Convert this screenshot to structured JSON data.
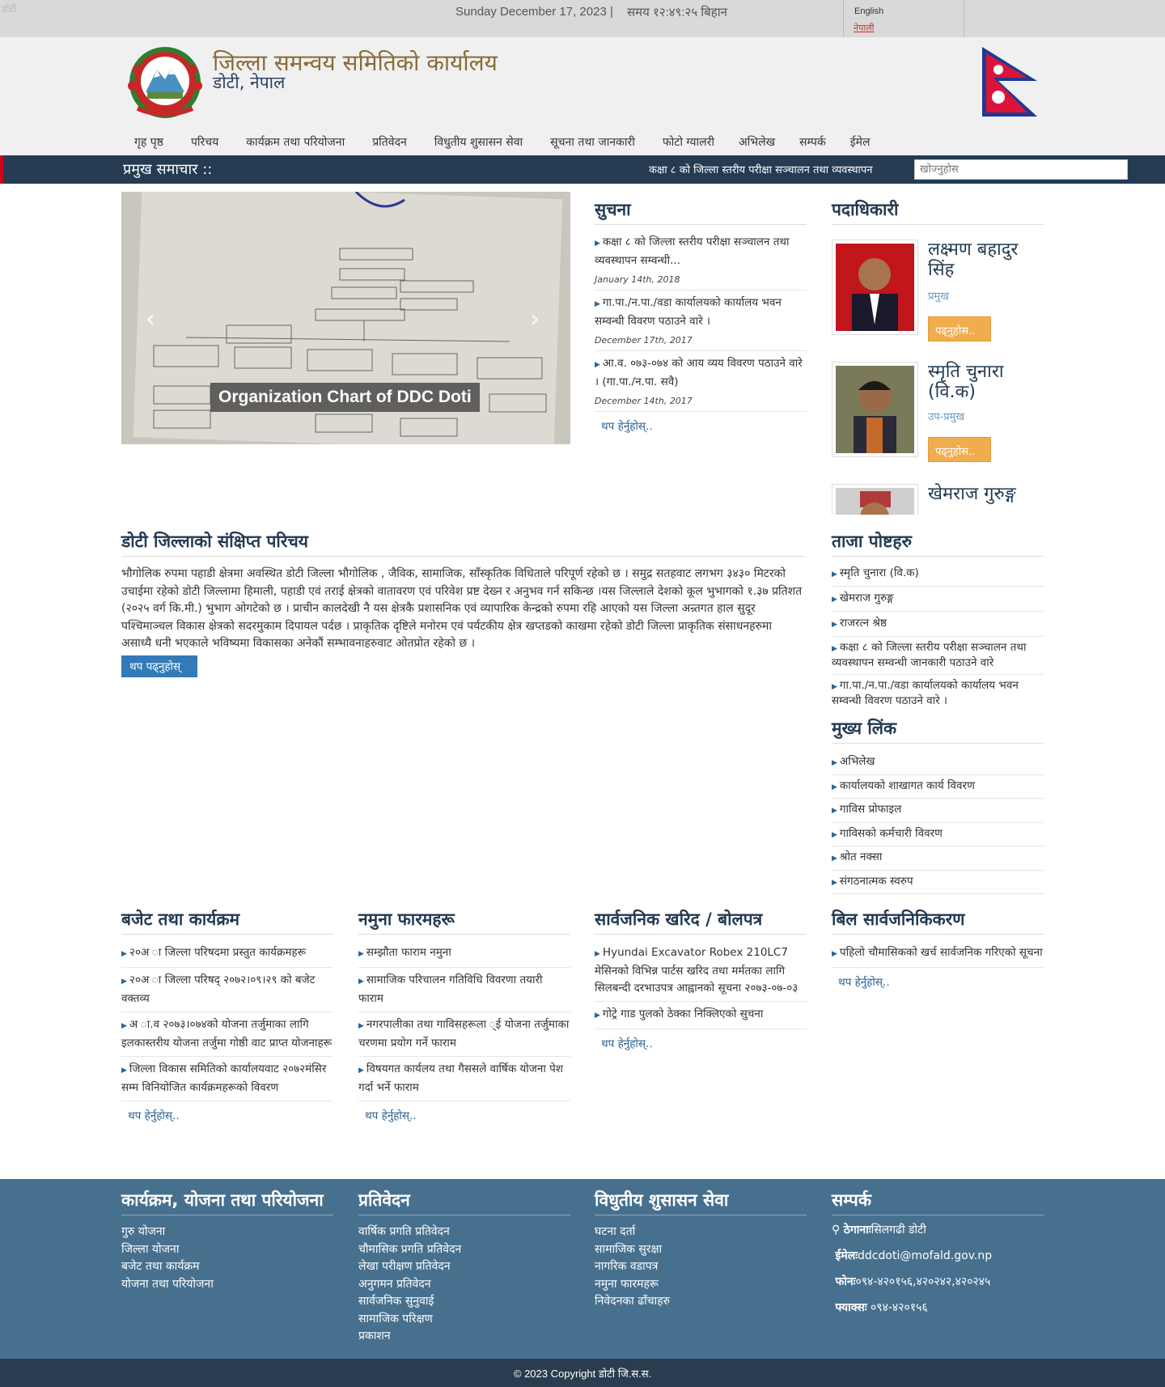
{
  "topbar": {
    "broken_image_alt": "डोटी",
    "date": "Sunday December 17, 2023 |",
    "time": "समय १२:४९:२५ बिहान",
    "lang_en": "English",
    "lang_np": "नेपाली"
  },
  "header": {
    "title": "जिल्ला समन्वय समितिको कार्यालय",
    "subtitle": "डोटी, नेपाल"
  },
  "nav": [
    "गृह पृष्ठ",
    "परिचय",
    "कार्यक्रम तथा परियोजना",
    "प्रतिवेदन",
    "विधुतीय शुसासन सेवा",
    "सूचना तथा जानकारी",
    "फोटो ग्यालरी",
    "अभिलेख",
    "सम्पर्क",
    "ईमेल"
  ],
  "newsbar": {
    "label": "प्रमुख समाचार ::",
    "ticker": "कक्षा ८ को जिल्ला स्तरीय परीक्षा सञ्चालन तथा व्यवस्थापन",
    "search_placeholder": "खोज्नुहोस"
  },
  "slider": {
    "caption": "Organization Chart of DDC Doti",
    "prev": "‹",
    "next": "›"
  },
  "notice": {
    "heading": "सुचना",
    "items": [
      {
        "text": "कक्षा ८ को जिल्ला स्तरीय परीक्षा सञ्चालन तथा व्यवस्थापन सम्वन्धी...",
        "date": "January 14th, 2018"
      },
      {
        "text": "गा.पा./न.पा./वडा कार्यालयको कार्यालय भवन सम्वन्धी विवरण पठाउने वारे ।",
        "date": "December 17th, 2017"
      },
      {
        "text": "आ.व. ०७३-०७४ को आय व्यय विवरण पठाउने वारे । (गा.पा./न.पा. सवै)",
        "date": "December 14th, 2017"
      }
    ],
    "more": "थप हेर्नुहोस्.."
  },
  "officials": {
    "heading": "पदाधिकारी",
    "people": [
      {
        "name": "लक्ष्मण बहादुर सिंह",
        "role": "प्रमुख",
        "button": "पढ्नुहोस.."
      },
      {
        "name": "स्मृति चुनारा (वि.क)",
        "role": "उप-प्रमुख",
        "button": "पढ्नुहोस.."
      },
      {
        "name": "खेमराज गुरुङ्ग",
        "role": "",
        "button": ""
      }
    ]
  },
  "intro": {
    "heading": "डोटी जिल्लाको संक्षिप्त परिचय",
    "text": "भौगोलिक रुपमा पहाडी क्षेत्रमा अवस्थित डोटी जिल्ला भौगोलिक , जैविक, सामाजिक, साँस्कृतिक विधिताले परिपूर्ण रहेको छ । समुद्र सतहवाट लगभग ३४३० मिटरको उचाईमा रहेको डोटी जिल्लामा हिमाली, पहाडी एवं तराई क्षेत्रको वातावरण एवं परिवेश प्रष्ट देख्न र अनुभव गर्न सकिन्छ ।यस जिल्लाले देशको कूल भुभागको १.३७ प्रतिशत (२०२५ वर्ग कि.मी.) भुभाग ओगटेको छ । प्राचीन कालदेखी नै यस क्षेत्रकै प्रशासनिक एवं व्यापारिक केन्द्रको रुपमा रहि आएको यस जिल्ला अन्र्तगत हाल सुदूर पश्चिमाञ्चल विकास क्षेत्रको सदरमुकाम दिपायल पर्दछ । प्राकृतिक दृष्टिले मनोरम एवं पर्यटकीय क्षेत्र खप्तडको काखमा रहेको डोटी जिल्ला प्राकृतिक संसाधनहरुमा असाध्यै धनी भएकाले भविष्यमा विकासका अनेकौं सम्भावनाहरुवाट ओतप्रोत रहेको छ ।",
    "read_more": "थप पढ्नुहोस्"
  },
  "latest_posts": {
    "heading": "ताजा पोष्टहरु",
    "items": [
      "स्मृति चुनारा (वि.क)",
      "खेमराज गुरुङ्ग",
      "राजरत्न श्रेष्ठ",
      "कक्षा ८ को जिल्ला स्तरीय परीक्षा सञ्चालन तथा व्यवस्थापन सम्वन्धी जानकारी पठाउने वारे",
      "गा.पा./न.पा./वडा कार्यालयको कार्यालय भवन सम्वन्धी विवरण पठाउने वारे ।"
    ]
  },
  "main_links": {
    "heading": "मुख्य लिंक",
    "items": [
      "अभिलेख",
      "कार्यालयको शाखागत कार्य विवरण",
      "गाविस प्रोफाइल",
      "गाविसको कर्मचारी विवरण",
      "श्रोत नक्सा",
      "संगठनात्मक स्वरुप"
    ]
  },
  "budget": {
    "heading": "बजेट तथा कार्यक्रम",
    "items": [
      "२०अ ा जिल्ला परिषदमा प्रस्तुत कार्यक्रमहरू",
      "२०अ ा जिल्ला परिषद् २०७२।०९।२९ को बजेट वक्तव्य",
      "अ ा.व २०७३।०७४को योजना तर्जुमाका लागि इलकास्तरीय योजना तर्जुमा गोष्ठी वाट प्राप्त योजनाहरू",
      "जिल्ला विकास समितिको कार्यालयवाट २०७२मंसिर सम्म विनियोजित कार्यक्रमहरूको विवरण"
    ],
    "more": "थप हेर्नुहोस्.."
  },
  "forms": {
    "heading": "नमुना फारमहरू",
    "items": [
      "सम्झौता फाराम नमुना",
      "सामाजिक परिचालन गतिविधि विवरणा तयारी फाराम",
      "नगरपालीका तथा गाविसहरूला ्ई योजना तर्जुमाका चरणमा प्रयोग गर्ने फाराम",
      "विषयगत कार्यलय तथा गैससले वार्षिक योजना पेश गर्दा भर्ने फाराम"
    ],
    "more": "थप हेर्नुहोस्.."
  },
  "procurement": {
    "heading": "सार्वजनिक खरिद / बोलपत्र",
    "items": [
      "Hyundai Excavator Robex 210LC7 मेसिनको विभिन्न पार्टस खरिद तथा मर्मतका लागि सिलबन्दी दरभाउपत्र आह्वानको सूचना २०७३-०७-०३",
      "गोट्रे गाड पुलको ठेक्का निक्लिएको सुचना"
    ],
    "more": "थप हेर्नुहोस्.."
  },
  "bill": {
    "heading": "बिल सार्वजनिकिकरण",
    "items": [
      "पहिलो चौमासिकको खर्च सार्वजनिक गरिएको सूचना"
    ],
    "more": "थप हेर्नुहोस्.."
  },
  "footer": {
    "col1": {
      "heading": "कार्यक्रम, योजना तथा परियोजना",
      "items": [
        "गुरु योजना",
        "जिल्ला योजना",
        "बजेट तथा कार्यक्रम",
        "योजना तथा परियोजना"
      ]
    },
    "col2": {
      "heading": "प्रतिवेदन",
      "items": [
        "वार्षिक प्रगति प्रतिवेदन",
        "चौमासिक प्रगति प्रतिवेदन",
        "लेखा परीक्षण प्रतिवेदन",
        "अनुगमन प्रतिवेदन",
        "सार्वजनिक सुनुवाई",
        "सामाजिक परिक्षण",
        "प्रकाशन"
      ]
    },
    "col3": {
      "heading": "विधुतीय शुसासन सेवा",
      "items": [
        "घटना दर्ता",
        "सामाजिक सुरक्षा",
        "नागरिक वडापत्र",
        "नमुना फारमहरू",
        "निवेदनका ढाँचाहरु"
      ]
    },
    "contact": {
      "heading": "सम्पर्क",
      "address_label": "ठेगानाः",
      "address": "सिलगढी डोटी",
      "email_label": "ईमेलः",
      "email": "ddcdoti@mofald.gov.np",
      "phone_label": "फोनः",
      "phone": "०९४-४२०१५६,४२०२४२,४२०२४५",
      "fax_label": "फ्याक्सः",
      "fax": " ०९४-४२०१५६"
    }
  },
  "copyright": "© 2023 Copyright डोटी जि.स.स.",
  "colors": {
    "navy": "#243b52",
    "footer": "#47708f",
    "accent_red": "#d0021b",
    "orange_button": "#f0ad4e",
    "blue_button": "#337ab7"
  }
}
